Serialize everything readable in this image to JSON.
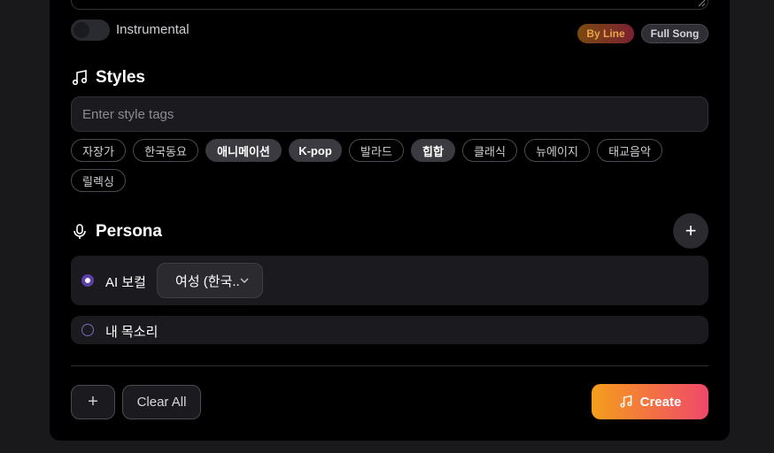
{
  "instrumental": {
    "label": "Instrumental",
    "enabled": false
  },
  "lyrics_mode": {
    "by_line": "By Line",
    "full_song": "Full Song"
  },
  "styles": {
    "title": "Styles",
    "input_placeholder": "Enter style tags",
    "tags": [
      {
        "label": "자장가",
        "selected": false
      },
      {
        "label": "한국동요",
        "selected": false
      },
      {
        "label": "애니메이션",
        "selected": true
      },
      {
        "label": "K-pop",
        "selected": true
      },
      {
        "label": "발라드",
        "selected": false
      },
      {
        "label": "힙합",
        "selected": true
      },
      {
        "label": "클래식",
        "selected": false
      },
      {
        "label": "뉴에이지",
        "selected": false
      },
      {
        "label": "태교음악",
        "selected": false
      },
      {
        "label": "릴렉싱",
        "selected": false
      }
    ]
  },
  "persona": {
    "title": "Persona",
    "options": [
      {
        "label": "AI 보컬",
        "selected": true,
        "voice": "여성 (한국.."
      },
      {
        "label": "내 목소리",
        "selected": false
      }
    ]
  },
  "footer": {
    "clear_label": "Clear All",
    "create_label": "Create"
  },
  "colors": {
    "create_gradient_start": "#f59e1b",
    "create_gradient_end": "#f0486a",
    "radio_accent": "#5b3ea6"
  },
  "icons": {
    "styles": "music-note-icon",
    "persona": "microphone-icon",
    "add": "plus-icon",
    "create": "music-note-icon"
  }
}
